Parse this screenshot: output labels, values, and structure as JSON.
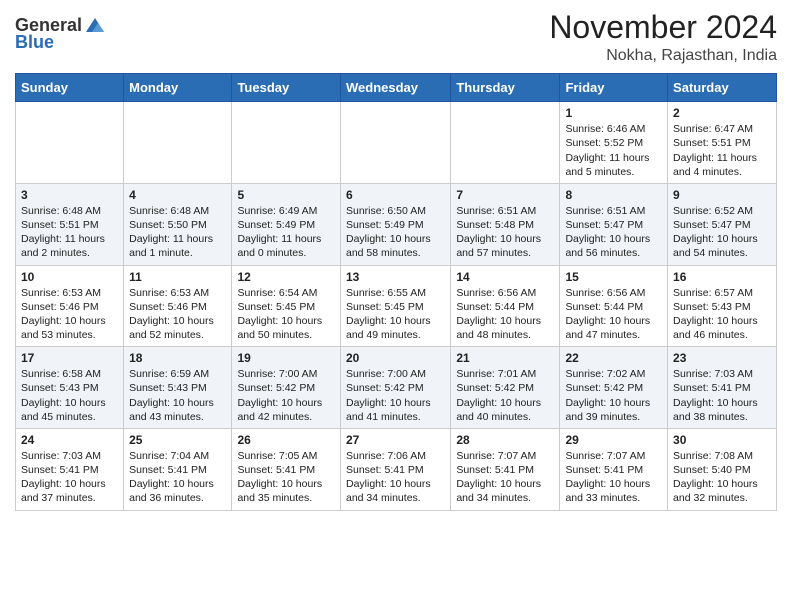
{
  "header": {
    "logo_general": "General",
    "logo_blue": "Blue",
    "month_title": "November 2024",
    "location": "Nokha, Rajasthan, India"
  },
  "days_of_week": [
    "Sunday",
    "Monday",
    "Tuesday",
    "Wednesday",
    "Thursday",
    "Friday",
    "Saturday"
  ],
  "weeks": [
    [
      {
        "day": "",
        "info": ""
      },
      {
        "day": "",
        "info": ""
      },
      {
        "day": "",
        "info": ""
      },
      {
        "day": "",
        "info": ""
      },
      {
        "day": "",
        "info": ""
      },
      {
        "day": "1",
        "info": "Sunrise: 6:46 AM\nSunset: 5:52 PM\nDaylight: 11 hours and 5 minutes."
      },
      {
        "day": "2",
        "info": "Sunrise: 6:47 AM\nSunset: 5:51 PM\nDaylight: 11 hours and 4 minutes."
      }
    ],
    [
      {
        "day": "3",
        "info": "Sunrise: 6:48 AM\nSunset: 5:51 PM\nDaylight: 11 hours and 2 minutes."
      },
      {
        "day": "4",
        "info": "Sunrise: 6:48 AM\nSunset: 5:50 PM\nDaylight: 11 hours and 1 minute."
      },
      {
        "day": "5",
        "info": "Sunrise: 6:49 AM\nSunset: 5:49 PM\nDaylight: 11 hours and 0 minutes."
      },
      {
        "day": "6",
        "info": "Sunrise: 6:50 AM\nSunset: 5:49 PM\nDaylight: 10 hours and 58 minutes."
      },
      {
        "day": "7",
        "info": "Sunrise: 6:51 AM\nSunset: 5:48 PM\nDaylight: 10 hours and 57 minutes."
      },
      {
        "day": "8",
        "info": "Sunrise: 6:51 AM\nSunset: 5:47 PM\nDaylight: 10 hours and 56 minutes."
      },
      {
        "day": "9",
        "info": "Sunrise: 6:52 AM\nSunset: 5:47 PM\nDaylight: 10 hours and 54 minutes."
      }
    ],
    [
      {
        "day": "10",
        "info": "Sunrise: 6:53 AM\nSunset: 5:46 PM\nDaylight: 10 hours and 53 minutes."
      },
      {
        "day": "11",
        "info": "Sunrise: 6:53 AM\nSunset: 5:46 PM\nDaylight: 10 hours and 52 minutes."
      },
      {
        "day": "12",
        "info": "Sunrise: 6:54 AM\nSunset: 5:45 PM\nDaylight: 10 hours and 50 minutes."
      },
      {
        "day": "13",
        "info": "Sunrise: 6:55 AM\nSunset: 5:45 PM\nDaylight: 10 hours and 49 minutes."
      },
      {
        "day": "14",
        "info": "Sunrise: 6:56 AM\nSunset: 5:44 PM\nDaylight: 10 hours and 48 minutes."
      },
      {
        "day": "15",
        "info": "Sunrise: 6:56 AM\nSunset: 5:44 PM\nDaylight: 10 hours and 47 minutes."
      },
      {
        "day": "16",
        "info": "Sunrise: 6:57 AM\nSunset: 5:43 PM\nDaylight: 10 hours and 46 minutes."
      }
    ],
    [
      {
        "day": "17",
        "info": "Sunrise: 6:58 AM\nSunset: 5:43 PM\nDaylight: 10 hours and 45 minutes."
      },
      {
        "day": "18",
        "info": "Sunrise: 6:59 AM\nSunset: 5:43 PM\nDaylight: 10 hours and 43 minutes."
      },
      {
        "day": "19",
        "info": "Sunrise: 7:00 AM\nSunset: 5:42 PM\nDaylight: 10 hours and 42 minutes."
      },
      {
        "day": "20",
        "info": "Sunrise: 7:00 AM\nSunset: 5:42 PM\nDaylight: 10 hours and 41 minutes."
      },
      {
        "day": "21",
        "info": "Sunrise: 7:01 AM\nSunset: 5:42 PM\nDaylight: 10 hours and 40 minutes."
      },
      {
        "day": "22",
        "info": "Sunrise: 7:02 AM\nSunset: 5:42 PM\nDaylight: 10 hours and 39 minutes."
      },
      {
        "day": "23",
        "info": "Sunrise: 7:03 AM\nSunset: 5:41 PM\nDaylight: 10 hours and 38 minutes."
      }
    ],
    [
      {
        "day": "24",
        "info": "Sunrise: 7:03 AM\nSunset: 5:41 PM\nDaylight: 10 hours and 37 minutes."
      },
      {
        "day": "25",
        "info": "Sunrise: 7:04 AM\nSunset: 5:41 PM\nDaylight: 10 hours and 36 minutes."
      },
      {
        "day": "26",
        "info": "Sunrise: 7:05 AM\nSunset: 5:41 PM\nDaylight: 10 hours and 35 minutes."
      },
      {
        "day": "27",
        "info": "Sunrise: 7:06 AM\nSunset: 5:41 PM\nDaylight: 10 hours and 34 minutes."
      },
      {
        "day": "28",
        "info": "Sunrise: 7:07 AM\nSunset: 5:41 PM\nDaylight: 10 hours and 34 minutes."
      },
      {
        "day": "29",
        "info": "Sunrise: 7:07 AM\nSunset: 5:41 PM\nDaylight: 10 hours and 33 minutes."
      },
      {
        "day": "30",
        "info": "Sunrise: 7:08 AM\nSunset: 5:40 PM\nDaylight: 10 hours and 32 minutes."
      }
    ]
  ]
}
